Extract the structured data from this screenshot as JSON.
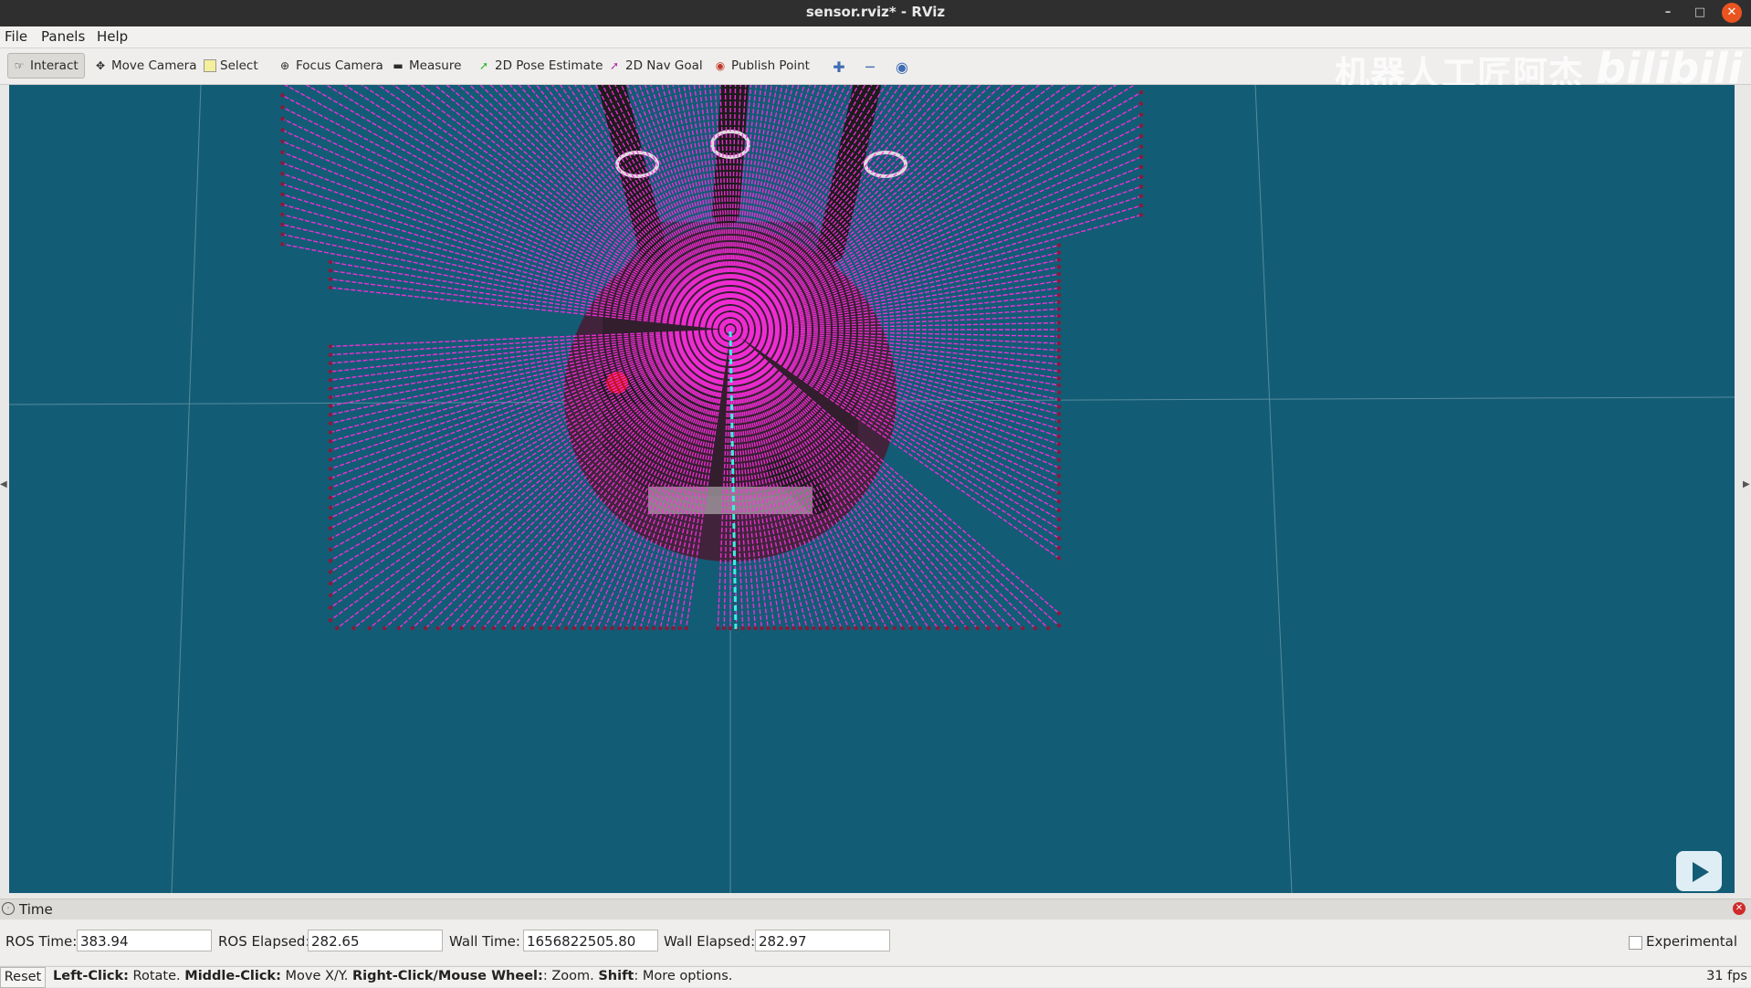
{
  "window": {
    "title": "sensor.rviz* - RViz"
  },
  "menubar": {
    "file": "File",
    "panels": "Panels",
    "help": "Help"
  },
  "toolbar": {
    "interact": "Interact",
    "move_camera": "Move Camera",
    "select": "Select",
    "focus_camera": "Focus Camera",
    "measure": "Measure",
    "pose_estimate": "2D Pose Estimate",
    "nav_goal": "2D Nav Goal",
    "publish_point": "Publish Point"
  },
  "watermark": {
    "text": "机器人工匠阿杰",
    "brand": "bilibili"
  },
  "time_panel": {
    "header": "Time",
    "ros_time_label": "ROS Time:",
    "ros_time": "383.94",
    "ros_elapsed_label": "ROS Elapsed:",
    "ros_elapsed": "282.65",
    "wall_time_label": "Wall Time:",
    "wall_time": "1656822505.80",
    "wall_elapsed_label": "Wall Elapsed:",
    "wall_elapsed": "282.97",
    "experimental_label": "Experimental"
  },
  "status_bar": {
    "reset": "Reset",
    "left_click": "Left-Click:",
    "left_click_action": " Rotate. ",
    "middle_click": "Middle-Click:",
    "middle_click_action": " Move X/Y. ",
    "right_click": "Right-Click/Mouse Wheel:",
    "right_click_action": ": Zoom. ",
    "shift": "Shift",
    "shift_action": ": More options.",
    "fps": "31 fps"
  },
  "colors": {
    "viewport_bg": "#135c75",
    "laser": "#ff2ee0",
    "laser_point": "#8a1a3a",
    "grid": "#8fb3c0"
  },
  "icons": [
    "interact-icon",
    "move-camera-icon",
    "select-icon",
    "focus-camera-icon",
    "measure-icon",
    "pose-estimate-icon",
    "nav-goal-icon",
    "publish-point-icon",
    "zoom-in-icon",
    "zoom-out-icon",
    "eye-icon",
    "clock-icon",
    "close-icon",
    "play-icon"
  ]
}
